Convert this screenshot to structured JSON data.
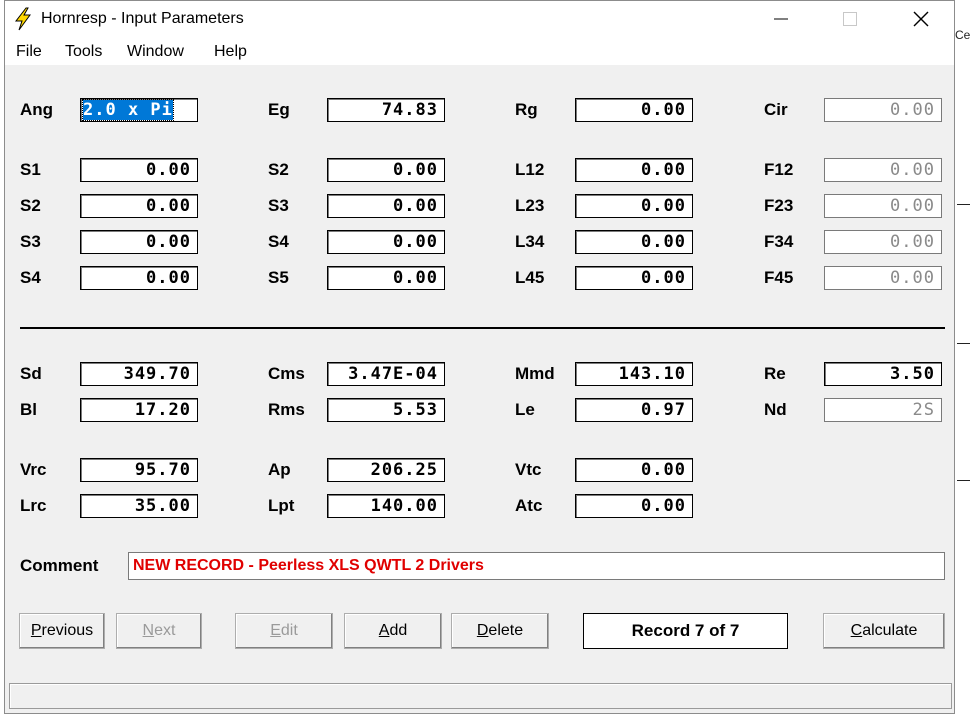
{
  "window": {
    "title": "Hornresp - Input Parameters",
    "accent": "#0078d7",
    "comment_color": "#e00000"
  },
  "menu": [
    "File",
    "Tools",
    "Window",
    "Help"
  ],
  "background_fragment": "Ce",
  "fields": {
    "ang": {
      "label": "Ang",
      "value": "2.0 x Pi"
    },
    "eg": {
      "label": "Eg",
      "value": "74.83"
    },
    "rg": {
      "label": "Rg",
      "value": "0.00"
    },
    "cir": {
      "label": "Cir",
      "value": "0.00"
    },
    "s1": {
      "label": "S1",
      "value": "0.00"
    },
    "s2a": {
      "label": "S2",
      "value": "0.00"
    },
    "l12": {
      "label": "L12",
      "value": "0.00"
    },
    "f12": {
      "label": "F12",
      "value": "0.00"
    },
    "s2b": {
      "label": "S2",
      "value": "0.00"
    },
    "s3a": {
      "label": "S3",
      "value": "0.00"
    },
    "l23": {
      "label": "L23",
      "value": "0.00"
    },
    "f23": {
      "label": "F23",
      "value": "0.00"
    },
    "s3b": {
      "label": "S3",
      "value": "0.00"
    },
    "s4a": {
      "label": "S4",
      "value": "0.00"
    },
    "l34": {
      "label": "L34",
      "value": "0.00"
    },
    "f34": {
      "label": "F34",
      "value": "0.00"
    },
    "s4b": {
      "label": "S4",
      "value": "0.00"
    },
    "s5": {
      "label": "S5",
      "value": "0.00"
    },
    "l45": {
      "label": "L45",
      "value": "0.00"
    },
    "f45": {
      "label": "F45",
      "value": "0.00"
    },
    "sd": {
      "label": "Sd",
      "value": "349.70"
    },
    "cms": {
      "label": "Cms",
      "value": "3.47E-04"
    },
    "mmd": {
      "label": "Mmd",
      "value": "143.10"
    },
    "re": {
      "label": "Re",
      "value": "3.50"
    },
    "bl": {
      "label": "Bl",
      "value": "17.20"
    },
    "rms": {
      "label": "Rms",
      "value": "5.53"
    },
    "le": {
      "label": "Le",
      "value": "0.97"
    },
    "nd": {
      "label": "Nd",
      "value": "2S"
    },
    "vrc": {
      "label": "Vrc",
      "value": "95.70"
    },
    "ap": {
      "label": "Ap",
      "value": "206.25"
    },
    "vtc": {
      "label": "Vtc",
      "value": "0.00"
    },
    "lrc": {
      "label": "Lrc",
      "value": "35.00"
    },
    "lpt": {
      "label": "Lpt",
      "value": "140.00"
    },
    "atc": {
      "label": "Atc",
      "value": "0.00"
    }
  },
  "comment": {
    "label": "Comment",
    "value": "NEW RECORD - Peerless XLS QWTL 2 Drivers"
  },
  "buttons": {
    "previous": {
      "first": "P",
      "rest": "revious"
    },
    "next": {
      "first": "N",
      "rest": "ext"
    },
    "edit": {
      "first": "E",
      "rest": "dit"
    },
    "add": {
      "first": "A",
      "rest": "dd"
    },
    "delete": {
      "first": "D",
      "rest": "elete"
    },
    "calculate": {
      "first": "C",
      "rest": "alculate"
    }
  },
  "record": "Record 7 of 7",
  "status": ""
}
